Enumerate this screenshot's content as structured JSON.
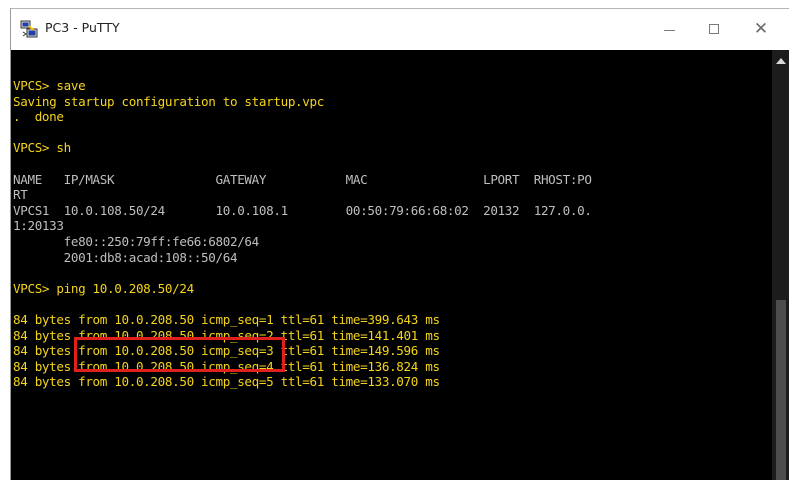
{
  "window": {
    "title": "PC3 - PuTTY",
    "icon": "putty-icon",
    "controls": {
      "minimize": "minimize-icon",
      "maximize": "maximize-icon",
      "close": "close-icon"
    },
    "close_glyph": "✕"
  },
  "colors": {
    "terminal_bg": "#000000",
    "output_text": "#f4d41c",
    "table_text": "#bfbfbf",
    "highlight_box": "#e0201b"
  },
  "terminal": {
    "lines": [
      {
        "text": "VPCS> save",
        "color": "yellow"
      },
      {
        "text": "Saving startup configuration to startup.vpc",
        "color": "yellow"
      },
      {
        "text": ".  done",
        "color": "yellow"
      },
      {
        "text": "",
        "color": "yellow"
      },
      {
        "text": "VPCS> sh",
        "color": "yellow"
      },
      {
        "text": "",
        "color": "yellow"
      },
      {
        "text": "NAME   IP/MASK              GATEWAY           MAC                LPORT  RHOST:PO",
        "color": "gray"
      },
      {
        "text": "RT",
        "color": "gray"
      },
      {
        "text": "VPCS1  10.0.108.50/24       10.0.108.1        00:50:79:66:68:02  20132  127.0.0.",
        "color": "gray"
      },
      {
        "text": "1:20133",
        "color": "gray"
      },
      {
        "text": "       fe80::250:79ff:fe66:6802/64",
        "color": "gray"
      },
      {
        "text": "       2001:db8:acad:108::50/64",
        "color": "gray"
      },
      {
        "text": "",
        "color": "yellow"
      },
      {
        "text": "VPCS> ping 10.0.208.50/24",
        "color": "yellow"
      },
      {
        "text": "",
        "color": "yellow"
      },
      {
        "text": "84 bytes from 10.0.208.50 icmp_seq=1 ttl=61 time=399.643 ms",
        "color": "yellow"
      },
      {
        "text": "84 bytes from 10.0.208.50 icmp_seq=2 ttl=61 time=141.401 ms",
        "color": "yellow"
      },
      {
        "text": "84 bytes from 10.0.208.50 icmp_seq=3 ttl=61 time=149.596 ms",
        "color": "yellow"
      },
      {
        "text": "84 bytes from 10.0.208.50 icmp_seq=4 ttl=61 time=136.824 ms",
        "color": "yellow"
      },
      {
        "text": "84 bytes from 10.0.208.50 icmp_seq=5 ttl=61 time=133.070 ms",
        "color": "yellow"
      }
    ]
  }
}
